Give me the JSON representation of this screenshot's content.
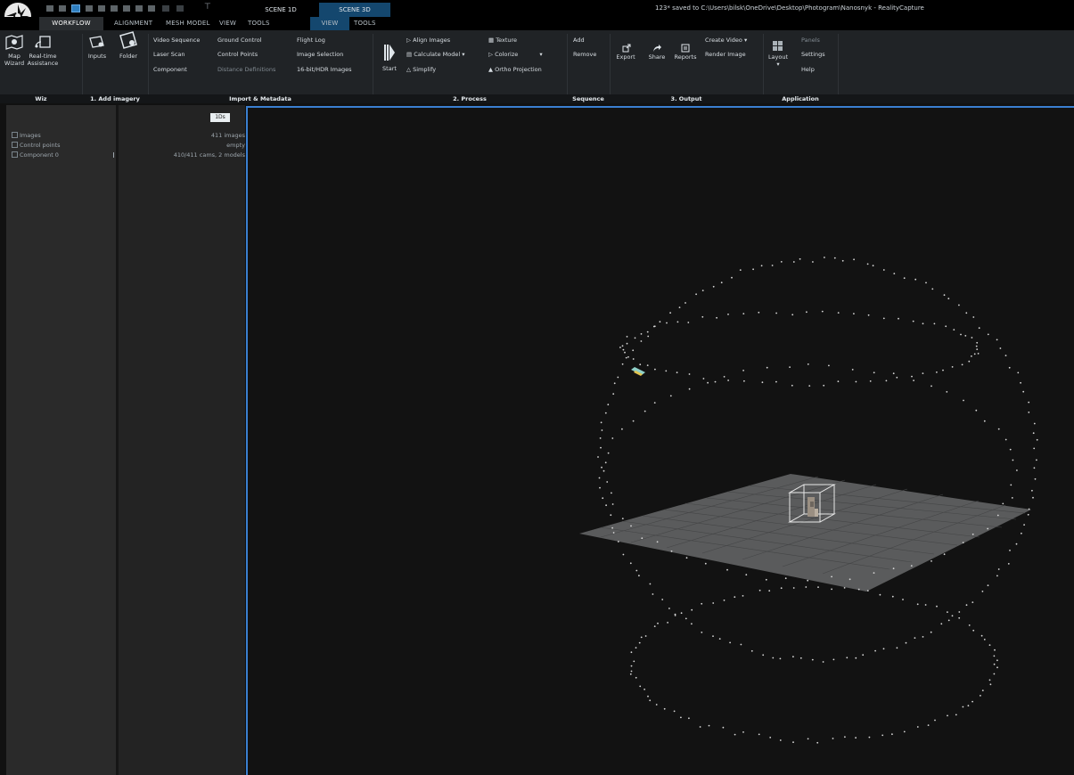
{
  "titlebar": {
    "scene_tabs": [
      "SCENE 1D",
      "SCENE 3D"
    ],
    "title": "123* saved to C:\\Users\\bilsk\\OneDrive\\Desktop\\Photogram\\Nanosnyk - RealityCapture",
    "pin_glyph": "⊤"
  },
  "tabs": {
    "workflow": "WORKFLOW",
    "alignment": "ALIGNMENT",
    "mesh_model": "MESH MODEL",
    "view": "VIEW",
    "tools": "TOOLS",
    "view_3d": "VIEW",
    "tools_3d": "TOOLS"
  },
  "ribbon": {
    "wiz": {
      "map_wizard": [
        "Map",
        "Wizard"
      ],
      "realtime": [
        "Real-time",
        "Assistance"
      ],
      "label": "Wiz"
    },
    "add_imagery": {
      "inputs": "Inputs",
      "folder": "Folder",
      "label": "1. Add imagery"
    },
    "import": {
      "col1": [
        "Video Sequence",
        "Laser Scan",
        "Component"
      ],
      "col2": [
        "Ground Control",
        "Control Points",
        "Distance Definitions"
      ],
      "col3": [
        "Flight Log",
        "Image Selection",
        "16-bit/HDR Images"
      ],
      "label": "Import & Metadata"
    },
    "process": {
      "start": "Start",
      "col1": [
        "Align Images",
        "Calculate Model",
        "Simplify"
      ],
      "col2": [
        "Texture",
        "Colorize",
        "Ortho Projection"
      ],
      "label": "2. Process"
    },
    "sequence": {
      "add": "Add",
      "remove": "Remove",
      "label": "Sequence"
    },
    "output": {
      "export": "Export",
      "share": "Share",
      "reports": "Reports",
      "create_video": "Create Video",
      "render_image": "Render Image",
      "label": "3. Output"
    },
    "application": {
      "layout": "Layout",
      "panels": "Panels",
      "settings": "Settings",
      "help": "Help",
      "label": "Application"
    }
  },
  "tree": {
    "items": [
      "Images",
      "Control points",
      "Component 0"
    ],
    "info_tag": "1Ds",
    "info": [
      "411 images",
      "empty",
      "410/411 cams, 2 models"
    ]
  },
  "colors": {
    "accent": "#3a7fd0",
    "scene_tab_active": "#14476e",
    "background": "#121212"
  }
}
